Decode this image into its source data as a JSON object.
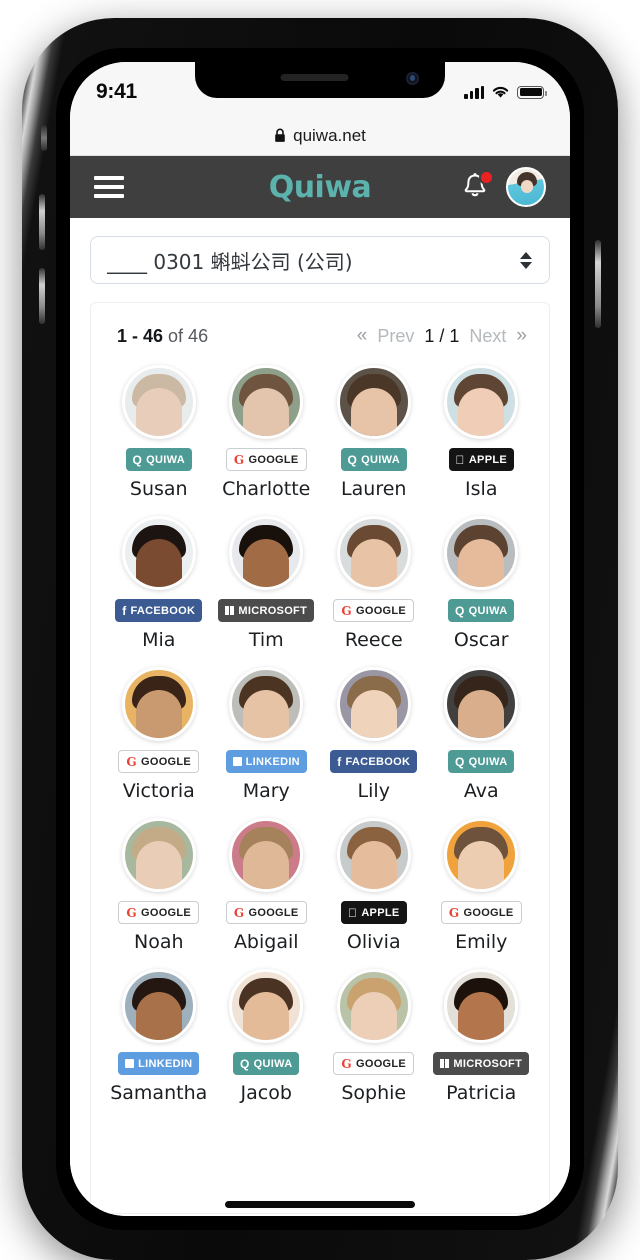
{
  "status_bar": {
    "time": "9:41",
    "signal_icon": "cellular-signal-icon",
    "wifi_icon": "wifi-icon",
    "battery_icon": "battery-full-icon"
  },
  "browser": {
    "lock_icon": "lock-icon",
    "url": "quiwa.net"
  },
  "header": {
    "menu_icon": "hamburger-menu-icon",
    "brand": "Quiwa",
    "bell_icon": "notification-bell-icon",
    "has_notification": true,
    "avatar_icon": "user-avatar",
    "background": "#3f3f3f",
    "brand_color": "#5cb3ae",
    "notification_dot_color": "#ec2222"
  },
  "company_select": {
    "value": "____ 0301 蝌蚪公司 (公司)",
    "caret_icon": "sort-updown-icon"
  },
  "pagination": {
    "range": "1 - 46",
    "of_label": "of 46",
    "first_icon": "«",
    "prev_label": "Prev",
    "current": "1 / 1",
    "next_label": "Next",
    "last_icon": "»"
  },
  "people": [
    {
      "name": "Susan",
      "provider": "QUIWA",
      "provider_class": "quiwa",
      "icon": "Q",
      "face": "#e8cdbb",
      "hair": "#cbb9a4",
      "bg": "#e9eced"
    },
    {
      "name": "Charlotte",
      "provider": "GOOGLE",
      "provider_class": "google",
      "icon": "G",
      "face": "#e3c4ad",
      "hair": "#6f553f",
      "bg": "#8fa08a"
    },
    {
      "name": "Lauren",
      "provider": "QUIWA",
      "provider_class": "quiwa",
      "icon": "Q",
      "face": "#e7c4a8",
      "hair": "#4b3728",
      "bg": "#5c5248"
    },
    {
      "name": "Isla",
      "provider": "APPLE",
      "provider_class": "apple",
      "icon": "",
      "face": "#f0cdb6",
      "hair": "#5e4534",
      "bg": "#cfe0e4"
    },
    {
      "name": "Mia",
      "provider": "FACEBOOK",
      "provider_class": "facebook",
      "icon": "f",
      "face": "#7a4b31",
      "hair": "#1c1410",
      "bg": "#eceff0"
    },
    {
      "name": "Tim",
      "provider": "MICROSOFT",
      "provider_class": "microsoft",
      "icon": "sq",
      "face": "#a06b45",
      "hair": "#17100b",
      "bg": "#e7e9ec"
    },
    {
      "name": "Reece",
      "provider": "GOOGLE",
      "provider_class": "google",
      "icon": "G",
      "face": "#e8c3a5",
      "hair": "#6b4a33",
      "bg": "#d9dcdd"
    },
    {
      "name": "Oscar",
      "provider": "QUIWA",
      "provider_class": "quiwa",
      "icon": "Q",
      "face": "#e5bb9b",
      "hair": "#5b4231",
      "bg": "#b9bdc0"
    },
    {
      "name": "Victoria",
      "provider": "GOOGLE",
      "provider_class": "google",
      "icon": "G",
      "face": "#c99a70",
      "hair": "#3a2418",
      "bg": "#e8b463"
    },
    {
      "name": "Mary",
      "provider": "LINKEDIN",
      "provider_class": "linkedin",
      "icon": "in",
      "face": "#e7c3a5",
      "hair": "#4c3422",
      "bg": "#bdbdb9"
    },
    {
      "name": "Lily",
      "provider": "FACEBOOK",
      "provider_class": "facebook",
      "icon": "f",
      "face": "#f0d3bb",
      "hair": "#8a6b4a",
      "bg": "#9a96a4"
    },
    {
      "name": "Ava",
      "provider": "QUIWA",
      "provider_class": "quiwa",
      "icon": "Q",
      "face": "#d9ae8c",
      "hair": "#35251a",
      "bg": "#42403f"
    },
    {
      "name": "Noah",
      "provider": "GOOGLE",
      "provider_class": "google",
      "icon": "G",
      "face": "#e9cdb6",
      "hair": "#c4ab87",
      "bg": "#a8b89e"
    },
    {
      "name": "Abigail",
      "provider": "GOOGLE",
      "provider_class": "google",
      "icon": "G",
      "face": "#dfb897",
      "hair": "#a5825b",
      "bg": "#cc7b88"
    },
    {
      "name": "Olivia",
      "provider": "APPLE",
      "provider_class": "apple",
      "icon": "",
      "face": "#e6bd9c",
      "hair": "#8a6240",
      "bg": "#c7cbcc"
    },
    {
      "name": "Emily",
      "provider": "GOOGLE",
      "provider_class": "google",
      "icon": "G",
      "face": "#edcdb2",
      "hair": "#6e523b",
      "bg": "#f0a23c"
    },
    {
      "name": "Samantha",
      "provider": "LINKEDIN",
      "provider_class": "linkedin",
      "icon": "in",
      "face": "#a9714a",
      "hair": "#241610",
      "bg": "#9fb0bd"
    },
    {
      "name": "Jacob",
      "provider": "QUIWA",
      "provider_class": "quiwa",
      "icon": "Q",
      "face": "#e4bb99",
      "hair": "#4b3324",
      "bg": "#f0e3d6"
    },
    {
      "name": "Sophie",
      "provider": "GOOGLE",
      "provider_class": "google",
      "icon": "G",
      "face": "#eccfb6",
      "hair": "#c9a270",
      "bg": "#b9c3a8"
    },
    {
      "name": "Patricia",
      "provider": "MICROSOFT",
      "provider_class": "microsoft",
      "icon": "sq",
      "face": "#b3754c",
      "hair": "#1d110c",
      "bg": "#e3e0d9"
    }
  ]
}
